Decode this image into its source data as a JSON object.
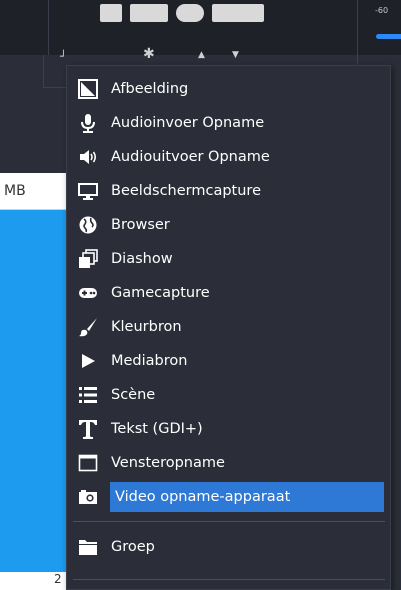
{
  "background": {
    "meter_label": "-60",
    "panel_text": "MB",
    "bottom_char": "2"
  },
  "menu": {
    "items": [
      {
        "label": "Afbeelding",
        "icon": "image-icon"
      },
      {
        "label": "Audioinvoer Opname",
        "icon": "microphone-icon"
      },
      {
        "label": "Audiouitvoer Opname",
        "icon": "speaker-icon"
      },
      {
        "label": "Beeldschermcapture",
        "icon": "monitor-icon"
      },
      {
        "label": "Browser",
        "icon": "globe-icon"
      },
      {
        "label": "Diashow",
        "icon": "slideshow-icon"
      },
      {
        "label": "Gamecapture",
        "icon": "gamepad-icon"
      },
      {
        "label": "Kleurbron",
        "icon": "paintbrush-icon"
      },
      {
        "label": "Mediabron",
        "icon": "play-icon"
      },
      {
        "label": "Scène",
        "icon": "list-icon"
      },
      {
        "label": "Tekst (GDI+)",
        "icon": "text-icon"
      },
      {
        "label": "Vensteropname",
        "icon": "window-icon"
      },
      {
        "label": "Video opname-apparaat",
        "icon": "camera-icon",
        "selected": true
      }
    ],
    "group_item": {
      "label": "Groep",
      "icon": "folder-icon"
    }
  },
  "colors": {
    "menu_background": "#2b2e38",
    "selection": "#2d79d5",
    "panel_blue": "#1c9bef"
  }
}
